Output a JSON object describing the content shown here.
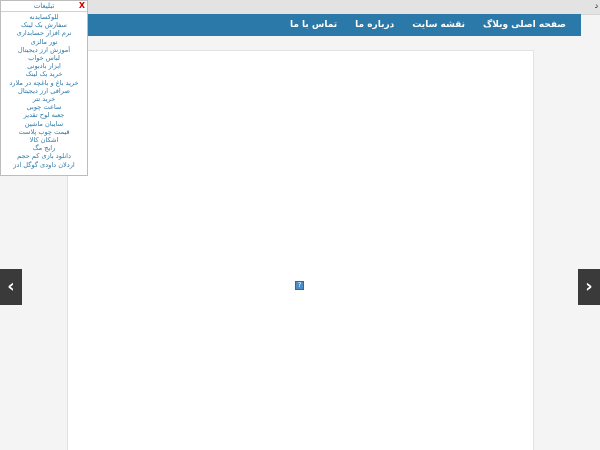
{
  "topbar": {
    "corner_text": "د"
  },
  "nav": {
    "items": [
      {
        "label": "صفحه اصلی وبلاگ"
      },
      {
        "label": "نقشه سایت"
      },
      {
        "label": "درباره ما"
      },
      {
        "label": "تماس با ما"
      }
    ]
  },
  "ads": {
    "title": "تبلیغات",
    "close_label": "X",
    "items": [
      "للوکسایدنه",
      "سفارش بک لینک",
      "نرم افزار حسابداری",
      "تور مالزی",
      "آموزش ارز دیجیتال",
      "لباس خواب",
      "ابزار بادبونی",
      "خرید بک لینک",
      "خرید باغ و باغچه در ملارد",
      "صرافی ارز دیجیتال",
      "خرید تتر",
      "ساعت چوبی",
      "جعبه لوح تقدیر",
      "سایبان ماشین",
      "قیمت چوب پلاست",
      "اشکان کالا",
      "رایج مگ",
      "دانلود بازی کم حجم",
      "اردلان داودی گوگل ادز"
    ]
  },
  "arrows": {
    "left": "‹",
    "right": "›"
  },
  "placeholder_icon": "?"
}
